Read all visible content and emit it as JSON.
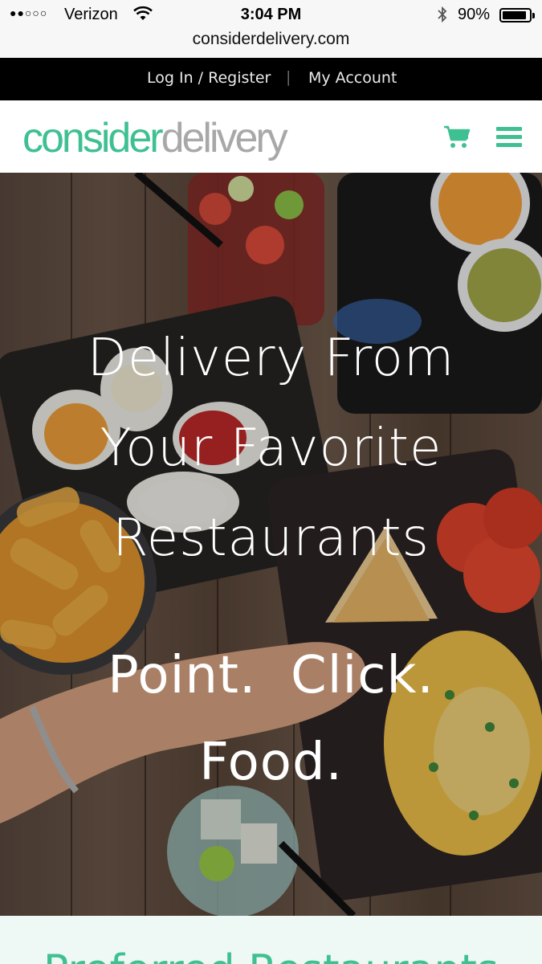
{
  "status_bar": {
    "signal": "●●○○○",
    "carrier": "Verizon",
    "time": "3:04 PM",
    "battery_percent": "90%",
    "battery_level": 0.9,
    "url": "considerdelivery.com",
    "icons": [
      "wifi-icon",
      "bluetooth-icon",
      "battery-icon"
    ]
  },
  "top_nav": {
    "login_label": "Log In / Register",
    "separator": "|",
    "account_label": "My Account"
  },
  "header": {
    "logo_part1": "consider",
    "logo_part2": "delivery",
    "icons": [
      "cart-icon",
      "hamburger-menu-icon"
    ]
  },
  "hero": {
    "title_lines": [
      "Delivery From",
      "Your Favorite",
      "Restaurants"
    ],
    "subtitle_lines": [
      "Point.  Click.",
      "Food."
    ]
  },
  "next_section": {
    "title": "Preferred Restaurants"
  },
  "colors": {
    "brand_green": "#3fc092",
    "logo_gray": "#a8a8a8",
    "topbar_bg": "#000000",
    "section_bg": "#eef8f4"
  }
}
